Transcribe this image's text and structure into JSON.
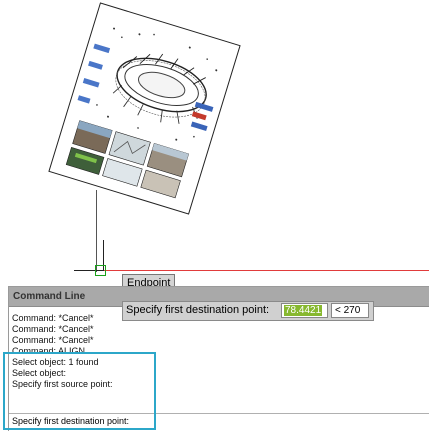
{
  "canvas": {
    "colors": {
      "red_axis": "#e13b3b",
      "snap_marker": "#1aa01a",
      "selection_frame": "#2ca7c9",
      "highlight": "#87b82f"
    },
    "snap_tooltip": "Endpoint"
  },
  "dynamic_input": {
    "label": "Specify first destination point:",
    "value": "78.4421",
    "angle": "< 270"
  },
  "command_line": {
    "title": "Command Line",
    "history": [
      "Command: *Cancel*",
      "Command: *Cancel*",
      "Command: *Cancel*",
      "Command: ALIGN",
      "Select object: 1 found",
      "Select object:",
      "Specify first source point:"
    ],
    "current_prompt": "Specify first destination point:"
  }
}
